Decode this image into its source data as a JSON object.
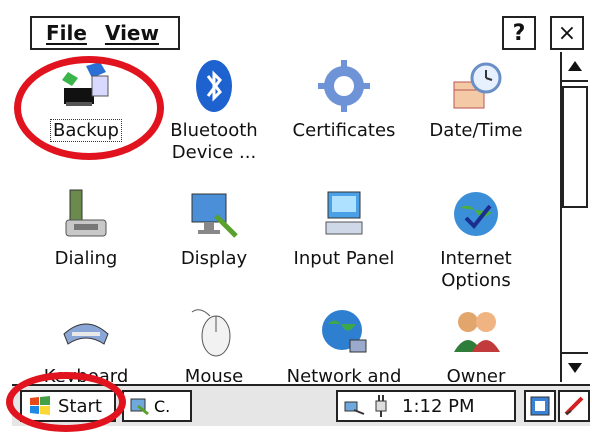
{
  "menubar": {
    "file_label": "File",
    "view_label": "View",
    "help_label": "?",
    "close_label": "×"
  },
  "icons": [
    {
      "label": "Backup",
      "icon": "backup-icon"
    },
    {
      "label": "Bluetooth Device ...",
      "icon": "bluetooth-icon"
    },
    {
      "label": "Certificates",
      "icon": "certificates-icon"
    },
    {
      "label": "Date/Time",
      "icon": "date-time-icon"
    },
    {
      "label": "Dialing",
      "icon": "dialing-icon"
    },
    {
      "label": "Display",
      "icon": "display-icon"
    },
    {
      "label": "Input Panel",
      "icon": "input-panel-icon"
    },
    {
      "label": "Internet Options",
      "icon": "internet-options-icon"
    },
    {
      "label": "Keyboard",
      "icon": "keyboard-icon"
    },
    {
      "label": "Mouse",
      "icon": "mouse-icon"
    },
    {
      "label": "Network and",
      "icon": "network-icon"
    },
    {
      "label": "Owner",
      "icon": "owner-icon"
    }
  ],
  "taskbar": {
    "start_label": "Start",
    "task_label": "C.",
    "time": "1:12 PM"
  },
  "colors": {
    "annotation": "#e0131e"
  }
}
